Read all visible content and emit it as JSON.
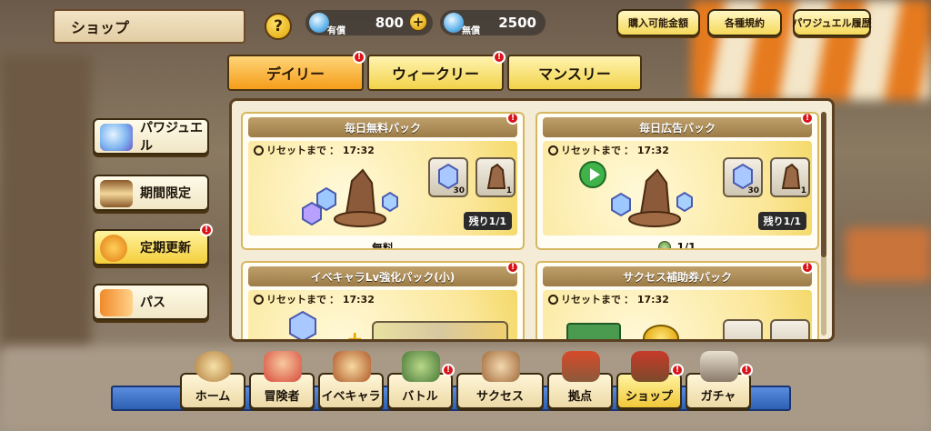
{
  "header": {
    "title": "ショップ",
    "help_label": "?",
    "paid_currency": {
      "label": "有償",
      "value": "800"
    },
    "free_currency": {
      "label": "無償",
      "value": "2500"
    },
    "plus_label": "+",
    "buttons": [
      "購入可能金額",
      "各種規約",
      "パワジュエル履歴"
    ]
  },
  "tabs": [
    {
      "label": "デイリー",
      "badge": "!"
    },
    {
      "label": "ウィークリー",
      "badge": "!"
    },
    {
      "label": "マンスリー",
      "badge": ""
    }
  ],
  "side_menu": [
    {
      "label": "パワジュエル",
      "icon": "jewel-icon",
      "badge": ""
    },
    {
      "label": "期間限定",
      "icon": "hourglass-icon",
      "badge": ""
    },
    {
      "label": "定期更新",
      "icon": "refresh-icon",
      "badge": "!"
    },
    {
      "label": "パス",
      "icon": "pass-ticket-icon",
      "badge": ""
    }
  ],
  "packs": [
    {
      "title": "毎日無料パック",
      "reset_label": "リセットまで",
      "reset_time": "： 17:32",
      "items": [
        "30",
        "1"
      ],
      "remaining": "残り1/1",
      "footer": "無料",
      "badge": "!"
    },
    {
      "title": "毎日広告パック",
      "reset_label": "リセットまで",
      "reset_time": "： 17:32",
      "items": [
        "30",
        "1"
      ],
      "remaining": "残り1/1",
      "footer": "1/1",
      "badge": "!"
    },
    {
      "title": "イベキャラLv強化パック(小)",
      "reset_label": "リセットまで",
      "reset_time": "： 17:32",
      "badge": "!"
    },
    {
      "title": "サクセス補助券パック",
      "reset_label": "リセットまで",
      "reset_time": "： 17:32",
      "badge": "!"
    }
  ],
  "bottom_nav": [
    {
      "label": "ホーム",
      "icon": "compass-icon",
      "badge": ""
    },
    {
      "label": "冒険者",
      "icon": "adventurer-icon",
      "badge": ""
    },
    {
      "label": "イベキャラ",
      "icon": "event-chara-icon",
      "badge": ""
    },
    {
      "label": "バトル",
      "icon": "battle-icon",
      "badge": "!"
    },
    {
      "label": "サクセス",
      "icon": "success-icon",
      "badge": ""
    },
    {
      "label": "拠点",
      "icon": "base-icon",
      "badge": ""
    },
    {
      "label": "ショップ",
      "icon": "shop-icon",
      "badge": "!"
    },
    {
      "label": "ガチャ",
      "icon": "gacha-icon",
      "badge": "!"
    }
  ],
  "colors": {
    "accent": "#f59d1a",
    "badge": "#d9141a",
    "nav": "#2d5fb3"
  }
}
